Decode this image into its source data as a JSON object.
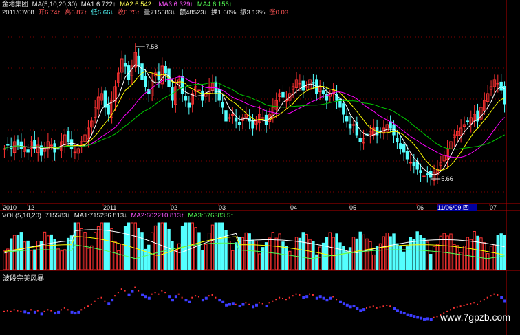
{
  "header": {
    "stock_name": "金地集团",
    "ma_params": "MA(5,10,20,30)",
    "ma1": "MA1:6.722↑",
    "ma2": "MA2:6.542↑",
    "ma3": "MA3:6.329↑",
    "ma4": "MA4:6.156↑",
    "date": "2011/07/08",
    "open": "开6.74↑",
    "high": "高6.87↑",
    "low": "低6.66↓",
    "close": "收6.75↑",
    "volume": "量715583↓",
    "amount": "额48523↓",
    "turnover": "换1.60%",
    "amplitude": "振3.13%",
    "change": "涨0.03"
  },
  "vol_header": {
    "params": "VOL(5,10,20)",
    "vol": "715583↓",
    "ma1": "MA1:715236.813↓",
    "ma2": "MA2:602210.813↑",
    "ma3": "MA3:576383.5↑"
  },
  "indicator_title": "波段完美风暴",
  "watermark": "www.7gpzb.com",
  "colors": {
    "up": "#ff3232",
    "down": "#54ffff",
    "ma1": "#ffffff",
    "ma2": "#ffff00",
    "ma3": "#ff00ff",
    "ma4": "#00c800",
    "grid": "#800000",
    "axis": "#b40000",
    "ind_up": "#ff3232",
    "ind_down": "#3c3cff"
  },
  "chart_data": {
    "type": "candlestick",
    "time_axis_labels": [
      "2010",
      "12",
      "2011",
      "02",
      "03",
      "04",
      "05",
      "06",
      "11/06/09,四",
      "07"
    ],
    "price_range": [
      5.3,
      8.0
    ],
    "annotations": [
      {
        "label": "7.58",
        "type": "high"
      },
      {
        "label": "5.66",
        "type": "low"
      }
    ],
    "candles_count": 150,
    "closes_estimated": [
      6.1,
      6.15,
      6.1,
      6.2,
      6.15,
      6.1,
      6.12,
      6.05,
      6.2,
      6.1,
      6.15,
      6.0,
      6.1,
      6.2,
      6.15,
      6.05,
      6.1,
      6.2,
      6.3,
      6.2,
      6.1,
      6.05,
      6.1,
      6.2,
      6.3,
      6.4,
      6.5,
      6.7,
      6.85,
      6.9,
      6.7,
      6.6,
      6.8,
      7.0,
      7.2,
      7.4,
      7.3,
      7.1,
      7.3,
      7.5,
      7.3,
      7.1,
      7.0,
      6.9,
      7.1,
      7.2,
      7.1,
      7.3,
      7.2,
      7.0,
      6.8,
      7.0,
      7.1,
      6.9,
      6.8,
      6.7,
      6.9,
      7.0,
      6.95,
      6.8,
      6.9,
      7.0,
      7.05,
      6.9,
      6.8,
      6.7,
      6.5,
      6.55,
      6.6,
      6.5,
      6.45,
      6.55,
      6.6,
      6.5,
      6.4,
      6.5,
      6.6,
      6.55,
      6.45,
      6.6,
      6.7,
      6.8,
      6.9,
      6.85,
      6.8,
      6.9,
      7.0,
      7.1,
      7.05,
      6.95,
      7.0,
      7.1,
      7.05,
      6.9,
      7.0,
      6.9,
      6.8,
      6.9,
      6.95,
      6.8,
      6.7,
      6.6,
      6.5,
      6.4,
      6.45,
      6.3,
      6.2,
      6.25,
      6.3,
      6.35,
      6.4,
      6.3,
      6.35,
      6.4,
      6.45,
      6.4,
      6.3,
      6.2,
      6.1,
      6.05,
      5.95,
      5.9,
      5.85,
      5.8,
      5.75,
      5.7,
      5.72,
      5.68,
      5.75,
      5.8,
      5.9,
      6.0,
      6.1,
      6.2,
      6.3,
      6.35,
      6.4,
      6.45,
      6.5,
      6.55,
      6.6,
      6.5,
      6.7,
      6.8,
      6.9,
      7.0,
      7.1,
      7.05,
      6.95,
      6.75
    ]
  }
}
